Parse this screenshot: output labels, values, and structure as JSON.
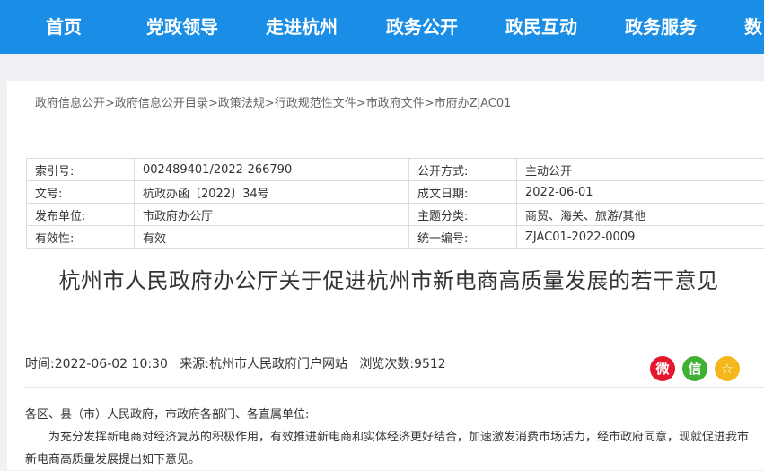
{
  "nav": {
    "items": [
      "首页",
      "党政领导",
      "走进杭州",
      "政务公开",
      "政民互动",
      "政务服务",
      "数"
    ]
  },
  "breadcrumb": {
    "items": [
      "政府信息公开",
      "政府信息公开目录",
      "政策法规",
      "行政规范性文件",
      "市政府文件",
      "市府办ZJAC01"
    ],
    "separator": ">"
  },
  "meta": {
    "rows": [
      {
        "k1": "索引号:",
        "v1": "002489401/2022-266790",
        "k2": "公开方式:",
        "v2": "主动公开"
      },
      {
        "k1": "文号:",
        "v1": "杭政办函〔2022〕34号",
        "k2": "成文日期:",
        "v2": "2022-06-01"
      },
      {
        "k1": "发布单位:",
        "v1": "市政府办公厅",
        "k2": "主题分类:",
        "v2": "商贸、海关、旅游/其他"
      },
      {
        "k1": "有效性:",
        "v1": "有效",
        "k2": "统一编号:",
        "v2": "ZJAC01-2022-0009"
      }
    ]
  },
  "article": {
    "title": "杭州市人民政府办公厅关于促进杭州市新电商高质量发展的若干意见",
    "time_label": "时间:",
    "time": "2022-06-02 10:30",
    "source_label": "来源:",
    "source": "杭州市人民政府门户网站",
    "views_label": "浏览次数:",
    "views": "9512",
    "salutation": "各区、县（市）人民政府，市政府各部门、各直属单位:",
    "paragraph1": "为充分发挥新电商对经济复苏的积极作用，有效推进新电商和实体经济更好结合，加速激发消费市场活力，经市政府同意，现就促进我市新电商高质量发展提出如下意见。"
  },
  "share": {
    "weibo": {
      "icon": "weibo-icon",
      "glyph": "微",
      "color": "#e6162d"
    },
    "wechat": {
      "icon": "wechat-icon",
      "glyph": "信",
      "color": "#3eb135"
    },
    "favorite": {
      "icon": "star-icon",
      "glyph": "☆",
      "color": "#f5b81c"
    }
  },
  "colors": {
    "nav_bg": "#1a8ee6"
  }
}
